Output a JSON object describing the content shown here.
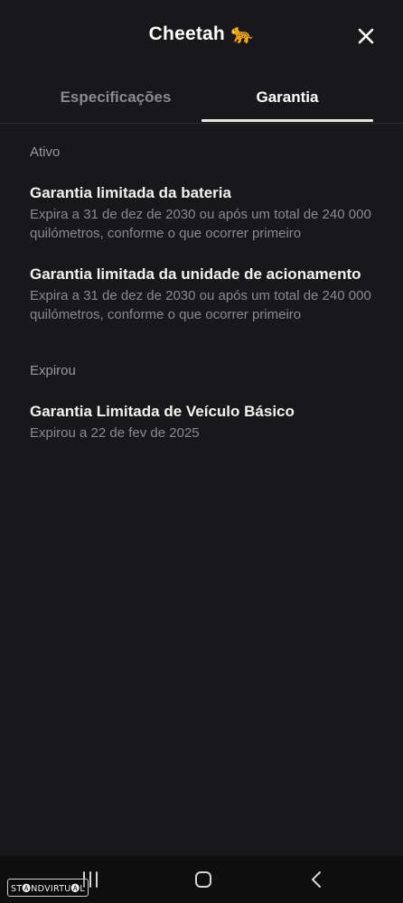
{
  "header": {
    "title": "Cheetah 🐆",
    "close_icon": "close-icon"
  },
  "tabs": [
    {
      "label": "Especificações",
      "active": false
    },
    {
      "label": "Garantia",
      "active": true
    }
  ],
  "sections": {
    "active": {
      "label": "Ativo",
      "items": [
        {
          "title": "Garantia limitada da bateria",
          "description": "Expira a 31 de dez de 2030 ou após um total de 240 000 quilómetros, conforme o que ocorrer primeiro"
        },
        {
          "title": "Garantia limitada da unidade de acionamento",
          "description": "Expira a 31 de dez de 2030 ou após um total de 240 000 quilómetros, conforme o que ocorrer primeiro"
        }
      ]
    },
    "expired": {
      "label": "Expirou",
      "items": [
        {
          "title": "Garantia Limitada de Veículo Básico",
          "description": "Expirou a 22 de fev de 2025"
        }
      ]
    }
  },
  "navbar": {
    "icons": [
      "recent-apps-icon",
      "home-icon",
      "back-icon"
    ]
  },
  "watermark": "ST🅐NDVIRTU🅐L",
  "colors": {
    "background": "#18181a",
    "text_primary": "#ffffff",
    "text_secondary": "#8a8a8e",
    "tab_indicator": "#e6e6e6"
  }
}
